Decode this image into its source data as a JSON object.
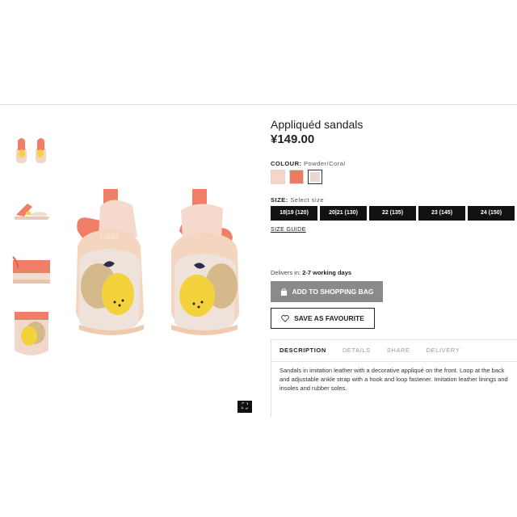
{
  "product": {
    "title": "Appliquéd sandals",
    "price": "¥149.00"
  },
  "colour": {
    "label": "COLOUR:",
    "value": "Powder/Coral",
    "swatches": [
      "#f6d4c6",
      "#ee7a60",
      "#e8d7d2"
    ]
  },
  "size": {
    "label": "SIZE:",
    "value": "Select size",
    "options": [
      "18|19 (120)",
      "20|21 (130)",
      "22 (135)",
      "23 (145)",
      "24 (150)"
    ],
    "guide": "SIZE GUIDE"
  },
  "delivery": {
    "prefix": "Delivers in:",
    "value": "2-7 working days"
  },
  "actions": {
    "add_to_bag": "ADD TO SHOPPING BAG",
    "save_favourite": "SAVE AS FAVOURITE"
  },
  "tabs": [
    "DESCRIPTION",
    "DETAILS",
    "SHARE",
    "DELIVERY"
  ],
  "description": "Sandals in imitation leather with a decorative appliqué on the front. Loop at the back and adjustable ankle strap with a hook and loop fastener. Imitation leather linings and insoles and rubber soles.",
  "icons": {
    "bag": "shopping-bag-icon",
    "heart": "heart-icon",
    "fullscreen": "fullscreen-icon"
  },
  "main_image_logo": "H&M"
}
